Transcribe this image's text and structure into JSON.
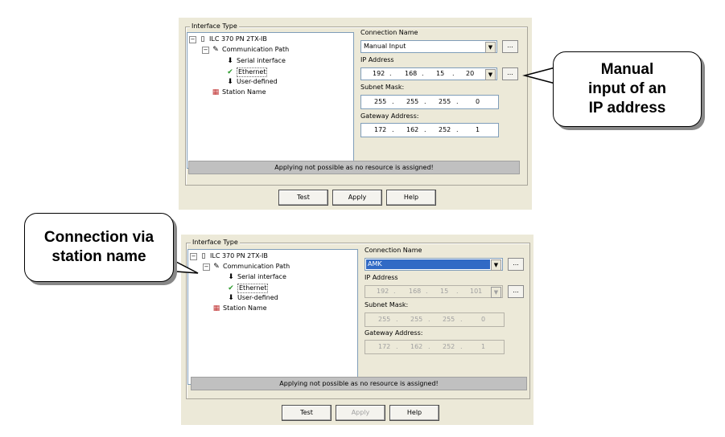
{
  "colors": {
    "panel": "#ece9d8",
    "selection": "#316ac5",
    "status_bar": "#c0c0c0"
  },
  "dialogs": [
    {
      "group_title": "Interface Type",
      "tree": {
        "device": "ILC 370 PN 2TX-IB",
        "communication_path": "Communication Path",
        "serial": "Serial interface",
        "ethernet": "Ethernet",
        "user_defined": "User-defined",
        "station_name": "Station Name"
      },
      "connection_name_label": "Connection Name",
      "connection_name_value": "Manual Input",
      "ip_address_label": "IP Address",
      "ip_address": [
        "192",
        "168",
        "15",
        "20"
      ],
      "subnet_label": "Subnet Mask:",
      "subnet": [
        "255",
        "255",
        "255",
        "0"
      ],
      "gateway_label": "Gateway Address:",
      "gateway": [
        "172",
        "162",
        "252",
        "1"
      ],
      "dots_label": "...",
      "status": "Applying not possible as no resource is assigned!",
      "buttons": {
        "test": "Test",
        "apply": "Apply",
        "help": "Help"
      }
    },
    {
      "group_title": "Interface Type",
      "tree": {
        "device": "ILC 370 PN 2TX-IB",
        "communication_path": "Communication Path",
        "serial": "Serial interface",
        "ethernet": "Ethernet",
        "user_defined": "User-defined",
        "station_name": "Station Name"
      },
      "connection_name_label": "Connection Name",
      "connection_name_value": "AMK",
      "ip_address_label": "IP Address",
      "ip_address": [
        "192",
        "168",
        "15",
        "101"
      ],
      "subnet_label": "Subnet Mask:",
      "subnet": [
        "255",
        "255",
        "255",
        "0"
      ],
      "gateway_label": "Gateway Address:",
      "gateway": [
        "172",
        "162",
        "252",
        "1"
      ],
      "dots_label": "...",
      "status": "Applying not possible as no resource is assigned!",
      "buttons": {
        "test": "Test",
        "apply": "Apply",
        "help": "Help"
      }
    }
  ],
  "callouts": {
    "manual": [
      "Manual",
      "input of an",
      "IP address"
    ],
    "station": [
      "Connection via",
      "station name"
    ]
  },
  "icons": {
    "device": "plc-device-icon",
    "path": "connection-plug-icon",
    "arrow": "down-arrow-icon",
    "check": "green-check-icon",
    "station": "station-name-icon"
  }
}
